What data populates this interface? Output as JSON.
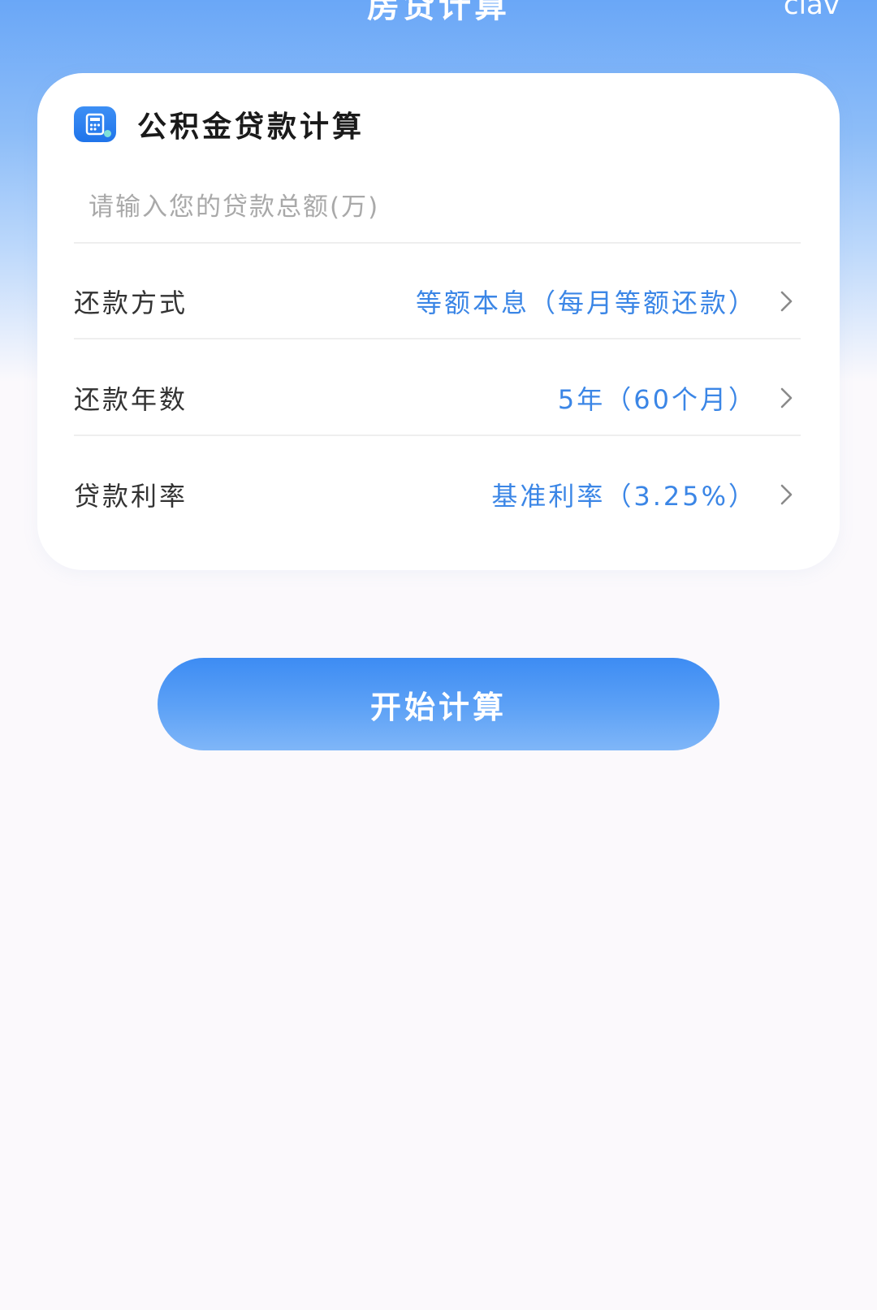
{
  "nav": {
    "title": "房贷计算",
    "right_text": "clav"
  },
  "card": {
    "icon": "calculator-icon",
    "title": "公积金贷款计算",
    "amount_placeholder": "请输入您的贷款总额(万)",
    "amount_value": ""
  },
  "rows": [
    {
      "label": "还款方式",
      "value": "等额本息（每月等额还款）"
    },
    {
      "label": "还款年数",
      "value": "5年（60个月）"
    },
    {
      "label": "贷款利率",
      "value": "基准利率（3.25%）"
    }
  ],
  "action": {
    "label": "开始计算"
  },
  "colors": {
    "accent": "#3b86e6",
    "header_top": "#6aa7f7",
    "button": "#4e98f5",
    "background": "#fbf9fc"
  }
}
